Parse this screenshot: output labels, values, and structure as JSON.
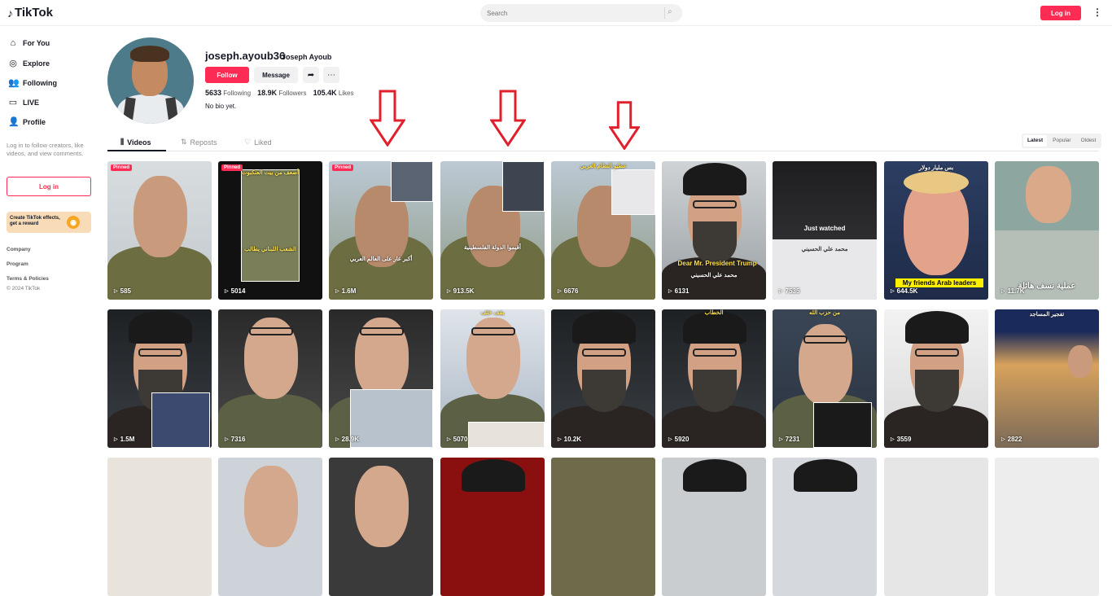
{
  "header": {
    "logo_text": "TikTok",
    "search_placeholder": "Search",
    "login_label": "Log in"
  },
  "sidebar": {
    "items": [
      {
        "label": "For You",
        "icon": "home-icon"
      },
      {
        "label": "Explore",
        "icon": "compass-icon"
      },
      {
        "label": "Following",
        "icon": "users-icon"
      },
      {
        "label": "LIVE",
        "icon": "live-icon"
      },
      {
        "label": "Profile",
        "icon": "user-icon"
      }
    ],
    "login_note": "Log in to follow creators, like videos, and view comments.",
    "login_label": "Log in",
    "effects_line1": "Create TikTok effects,",
    "effects_line2": "get a reward",
    "footer": {
      "company": "Company",
      "program": "Program",
      "terms": "Terms & Policies",
      "copyright": "© 2024 TikTok"
    }
  },
  "profile": {
    "username": "joseph.ayoub36",
    "nickname": "Joseph Ayoub",
    "follow_label": "Follow",
    "message_label": "Message",
    "following_count": "5633",
    "following_label": "Following",
    "followers_count": "18.9K",
    "followers_label": "Followers",
    "likes_count": "105.4K",
    "likes_label": "Likes",
    "bio": "No bio yet."
  },
  "tabs": {
    "videos": "Videos",
    "reposts": "Reposts",
    "liked": "Liked"
  },
  "sort": {
    "latest": "Latest",
    "popular": "Popular",
    "oldest": "Oldest"
  },
  "videos": [
    {
      "views": "585",
      "pinned": "Pinned"
    },
    {
      "views": "5014",
      "pinned": "Pinned",
      "caption": "أضعف من بيت العنكبوت",
      "caption2": "الشعب اللبناني يطالب"
    },
    {
      "views": "1.6M",
      "pinned": "Pinned",
      "caption": "أكبر عار على العالم العربي"
    },
    {
      "views": "913.5K",
      "caption": "أقيموا الدولة الفلسطينية"
    },
    {
      "views": "6676",
      "caption": "عطيو النظام العربي"
    },
    {
      "views": "6131",
      "tag": "Dear Mr. President Trump",
      "caption": "محمد علي الحسيني"
    },
    {
      "views": "7535",
      "watched": "Just watched",
      "caption": "محمد علي الحسيني"
    },
    {
      "views": "644.5K",
      "tag": "My friends Arab leaders",
      "caption": "بس مليار دولار"
    },
    {
      "views": "11.7K",
      "caption": "عملية نسف هائلة"
    },
    {
      "views": "1.5M"
    },
    {
      "views": "7316"
    },
    {
      "views": "28.9K"
    },
    {
      "views": "5070",
      "caption": "يقف خلف"
    },
    {
      "views": "10.2K"
    },
    {
      "views": "5920",
      "caption": "الخطاب"
    },
    {
      "views": "7231",
      "caption": "من حزب الله"
    },
    {
      "views": "3559"
    },
    {
      "views": "2822",
      "caption": "تفجير المساجد"
    }
  ]
}
